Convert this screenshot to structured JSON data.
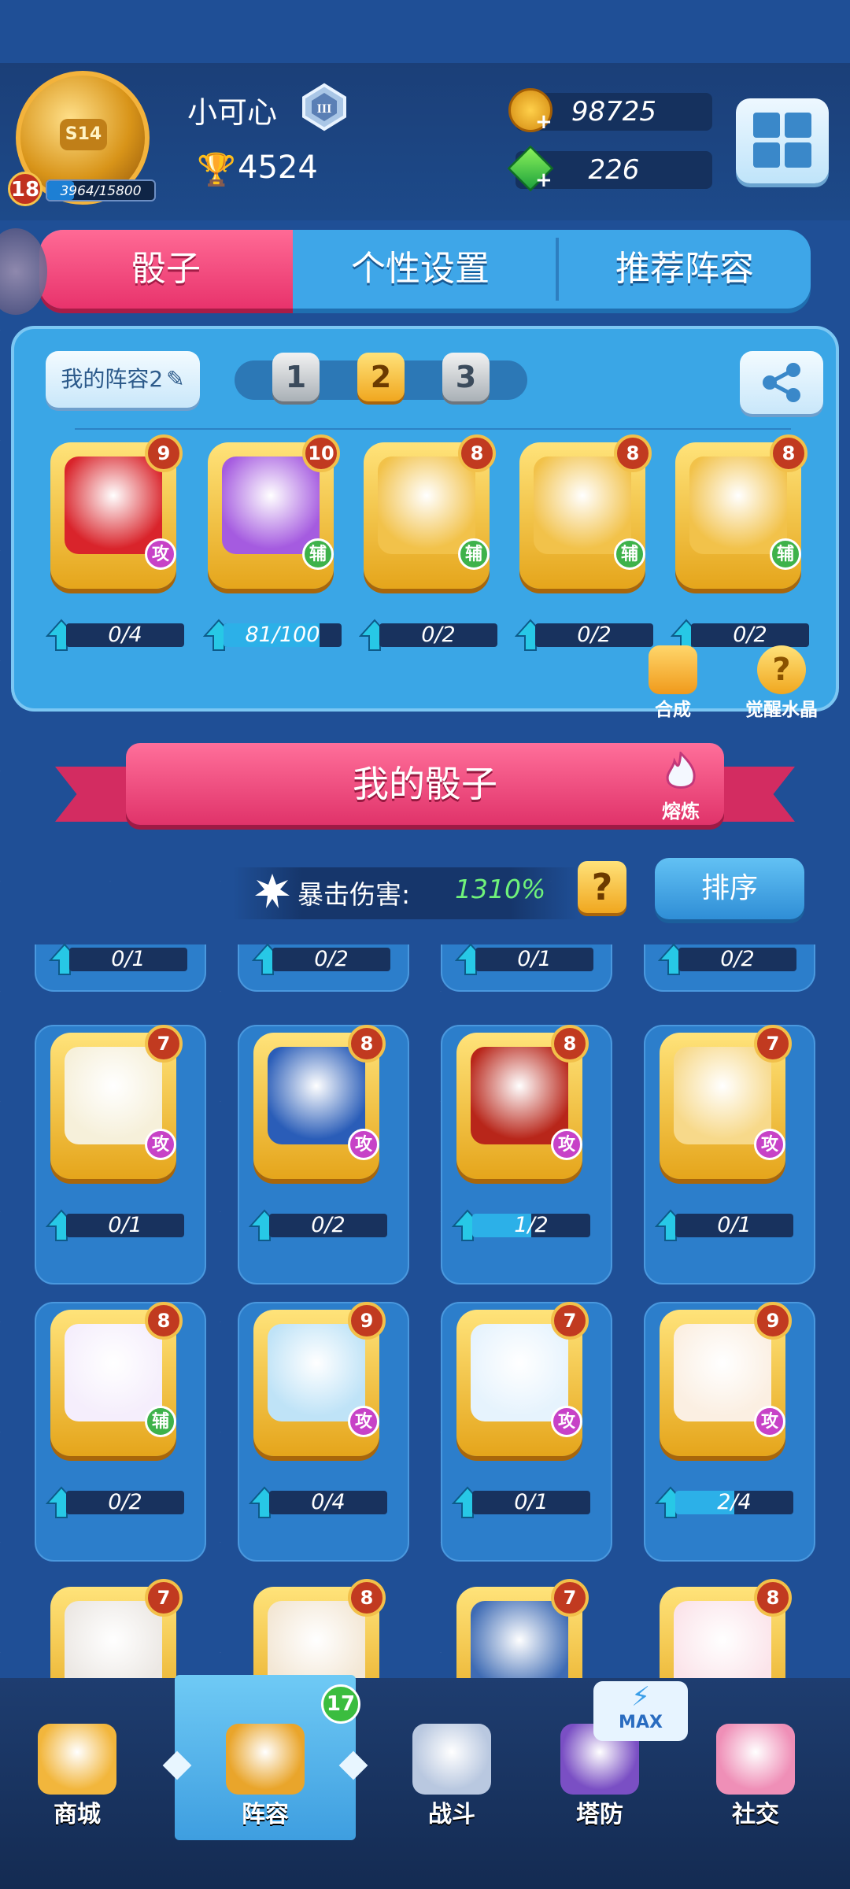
{
  "player": {
    "name": "小可心",
    "season_badge": "S14",
    "level": "18",
    "xp_text": "3964/15800",
    "xp_fraction": 0.25,
    "trophies": "4524",
    "rank_numeral": "III"
  },
  "currency": {
    "gold": "98725",
    "gems": "226"
  },
  "tabs": [
    {
      "label": "骰子",
      "active": true
    },
    {
      "label": "个性设置",
      "active": false
    },
    {
      "label": "推荐阵容",
      "active": false
    }
  ],
  "deck": {
    "name_button": "我的阵容2",
    "pages": [
      "1",
      "2",
      "3"
    ],
    "active_page": "2",
    "cards": [
      {
        "level": "9",
        "type": "攻",
        "progress": "0/4",
        "fill": 0,
        "icon": "dragon-swirl-icon",
        "color": "#d9242b"
      },
      {
        "level": "10",
        "type": "辅",
        "progress": "81/100",
        "fill": 0.81,
        "icon": "magic-hat-icon",
        "color": "#a55be0"
      },
      {
        "level": "8",
        "type": "辅",
        "progress": "0/2",
        "fill": 0,
        "icon": "purple-altar-icon",
        "color": "#f2c24a"
      },
      {
        "level": "8",
        "type": "辅",
        "progress": "0/2",
        "fill": 0,
        "icon": "red-hat-icon",
        "color": "#f2c24a"
      },
      {
        "level": "8",
        "type": "辅",
        "progress": "0/2",
        "fill": 0,
        "icon": "silhouette-pair-icon",
        "color": "#f2c24a"
      }
    ],
    "tools": [
      {
        "label": "合成",
        "icon": "puzzle-icon"
      },
      {
        "label": "觉醒水晶",
        "icon": "awaken-crystal-icon"
      }
    ]
  },
  "section": {
    "title": "我的骰子",
    "smelt_label": "熔炼",
    "crit_label": "暴击伤害:",
    "crit_value": "1310%",
    "sort_label": "排序"
  },
  "top_row_progress": [
    {
      "text": "0/1",
      "fill": 0
    },
    {
      "text": "0/2",
      "fill": 0
    },
    {
      "text": "0/1",
      "fill": 0
    },
    {
      "text": "0/2",
      "fill": 0
    }
  ],
  "dice_rows": [
    [
      {
        "level": "7",
        "type": "攻",
        "progress": "0/1",
        "fill": 0,
        "icon": "panda-icon",
        "color": "#f6f0da"
      },
      {
        "level": "8",
        "type": "攻",
        "progress": "0/2",
        "fill": 0,
        "icon": "blue-lotus-icon",
        "color": "#2a5db8"
      },
      {
        "level": "8",
        "type": "攻",
        "progress": "1/2",
        "fill": 0.5,
        "icon": "fire-burst-icon",
        "color": "#b8261a"
      },
      {
        "level": "7",
        "type": "攻",
        "progress": "0/1",
        "fill": 0,
        "icon": "golden-bull-icon",
        "color": "#f7d98a"
      }
    ],
    [
      {
        "level": "8",
        "type": "辅",
        "progress": "0/2",
        "fill": 0,
        "icon": "purple-altar-icon",
        "color": "#f5eefc"
      },
      {
        "level": "9",
        "type": "攻",
        "progress": "0/4",
        "fill": 0,
        "icon": "ice-sword-icon",
        "color": "#bfe3f7"
      },
      {
        "level": "7",
        "type": "攻",
        "progress": "0/1",
        "fill": 0,
        "icon": "crystal-sword-icon",
        "color": "#e6f3fd"
      },
      {
        "level": "9",
        "type": "攻",
        "progress": "2/4",
        "fill": 0.5,
        "icon": "war-banner-icon",
        "color": "#fbefe2"
      }
    ],
    [
      {
        "level": "7",
        "icon": "volcano-icon",
        "color": "#ece8e4"
      },
      {
        "level": "8",
        "icon": "witch-hat-icon",
        "color": "#f3e7d5"
      },
      {
        "level": "7",
        "icon": "moon-maiden-icon",
        "color": "#3e6bb4"
      },
      {
        "level": "8",
        "icon": "cherry-blossom-icon",
        "color": "#fbe4ea"
      }
    ]
  ],
  "nav": [
    {
      "label": "商城",
      "icon": "shop-chest-icon",
      "active": false
    },
    {
      "label": "阵容",
      "icon": "cannon-icon",
      "active": true,
      "badge": "17"
    },
    {
      "label": "战斗",
      "icon": "crossed-swords-icon",
      "active": false
    },
    {
      "label": "塔防",
      "icon": "tower-portal-icon",
      "active": false,
      "tag": "MAX"
    },
    {
      "label": "社交",
      "icon": "pink-mascot-icon",
      "active": false
    }
  ]
}
